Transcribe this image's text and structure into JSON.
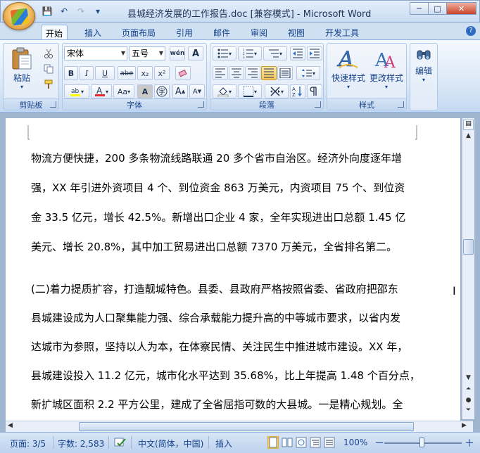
{
  "window": {
    "title": "县城经济发展的工作报告.doc [兼容模式] - Microsoft Word",
    "min_label": "─",
    "max_label": "□",
    "close_label": "✕"
  },
  "qat": {
    "save": "💾",
    "undo": "↶",
    "redo": "↷",
    "more": "▾"
  },
  "tabs": [
    "开始",
    "插入",
    "页面布局",
    "引用",
    "邮件",
    "审阅",
    "视图",
    "开发工具"
  ],
  "active_tab": "开始",
  "help": "?",
  "ribbon": {
    "clipboard": {
      "label": "剪贴板",
      "paste": "粘贴"
    },
    "font": {
      "label": "字体",
      "font_name": "宋体",
      "font_size": "五号",
      "grow": "A",
      "shrink": "A",
      "bold": "B",
      "italic": "I",
      "underline": "U",
      "strike": "abe",
      "subscript": "x₂",
      "superscript": "x²",
      "change_case": "Aa",
      "char_border": "A",
      "phonetic": "wén",
      "enclose": "字"
    },
    "paragraph": {
      "label": "段落"
    },
    "styles": {
      "label": "样式",
      "quick_styles": "快速样式",
      "change_styles": "更改样式"
    },
    "editing": {
      "label": "",
      "edit": "编辑"
    }
  },
  "document": {
    "lines": [
      "物流方便快捷，200 多条物流线路联通 20 多个省市自治区。经济外向度逐年增",
      "强，XX 年引进外资项目 4 个、到位资金 863 万美元，内资项目 75 个、到位资",
      "金 33.5 亿元，增长 42.5%。新增出口企业 4 家，全年实现进出口总额 1.45 亿",
      "美元、增长 20.8%，其中加工贸易进出口总额 7370 万美元，全省排名第二。",
      "(二)着力提质扩容，打造靓城特色。县委、县政府严格按照省委、省政府把邵东",
      "县城建设成为人口聚集能力强、综合承载能力提升高的中等城市要求，以省内发",
      "达城市为参照，坚持以人为本，在体察民情、关注民生中推进城市建设。XX 年，",
      "县城建设投入 11.2 亿元，城市化水平达到 35.68%，比上年提高 1.48 个百分点，",
      "新扩城区面积 2.2 平方公里，建成了全省屈指可数的大县城。一是精心规划。全"
    ]
  },
  "status": {
    "page": "页面: 3/5",
    "words": "字数: 2,583",
    "language": "中文(简体，中国)",
    "insert_mode": "插入",
    "zoom": "100%",
    "zoom_out": "－",
    "zoom_in": "＋",
    "zoom_level": 1.0
  }
}
